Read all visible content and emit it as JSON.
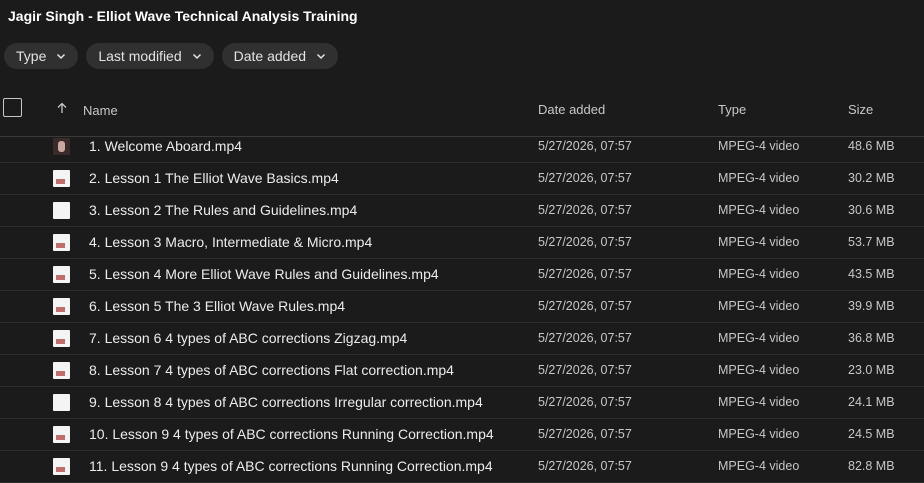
{
  "page_title": "Jagir Singh - Elliot Wave Technical Analysis Training",
  "filters": [
    {
      "label": "Type",
      "icon": "chevron-down-icon"
    },
    {
      "label": "Last modified",
      "icon": "chevron-down-icon"
    },
    {
      "label": "Date added",
      "icon": "chevron-down-icon"
    }
  ],
  "columns": {
    "name": "Name",
    "date_added": "Date added",
    "type": "Type",
    "size": "Size"
  },
  "files": [
    {
      "name": "1. Welcome Aboard.mp4",
      "date": "5/27/2026, 07:57",
      "type": "MPEG-4 video",
      "size": "48.6 MB",
      "thumb": "photo"
    },
    {
      "name": "2. Lesson 1 The Elliot Wave Basics.mp4",
      "date": "5/27/2026, 07:57",
      "type": "MPEG-4 video",
      "size": "30.2 MB",
      "thumb": "slide"
    },
    {
      "name": "3. Lesson 2 The Rules and Guidelines.mp4",
      "date": "5/27/2026, 07:57",
      "type": "MPEG-4 video",
      "size": "30.6 MB",
      "thumb": "blank"
    },
    {
      "name": "4. Lesson 3 Macro, Intermediate & Micro.mp4",
      "date": "5/27/2026, 07:57",
      "type": "MPEG-4 video",
      "size": "53.7 MB",
      "thumb": "slide"
    },
    {
      "name": "5. Lesson 4 More Elliot Wave Rules and Guidelines.mp4",
      "date": "5/27/2026, 07:57",
      "type": "MPEG-4 video",
      "size": "43.5 MB",
      "thumb": "slide"
    },
    {
      "name": "6. Lesson 5 The 3 Elliot Wave Rules.mp4",
      "date": "5/27/2026, 07:57",
      "type": "MPEG-4 video",
      "size": "39.9 MB",
      "thumb": "slide"
    },
    {
      "name": "7. Lesson 6 4 types of ABC corrections Zigzag.mp4",
      "date": "5/27/2026, 07:57",
      "type": "MPEG-4 video",
      "size": "36.8 MB",
      "thumb": "slide"
    },
    {
      "name": "8. Lesson 7 4 types of ABC corrections Flat correction.mp4",
      "date": "5/27/2026, 07:57",
      "type": "MPEG-4 video",
      "size": "23.0 MB",
      "thumb": "slide"
    },
    {
      "name": "9. Lesson 8 4 types of ABC corrections Irregular correction.mp4",
      "date": "5/27/2026, 07:57",
      "type": "MPEG-4 video",
      "size": "24.1 MB",
      "thumb": "blank"
    },
    {
      "name": "10. Lesson 9 4 types of ABC corrections Running Correction.mp4",
      "date": "5/27/2026, 07:57",
      "type": "MPEG-4 video",
      "size": "24.5 MB",
      "thumb": "slide"
    },
    {
      "name": "11. Lesson 9 4 types of ABC corrections Running Correction.mp4",
      "date": "5/27/2026, 07:57",
      "type": "MPEG-4 video",
      "size": "82.8 MB",
      "thumb": "slide"
    }
  ]
}
